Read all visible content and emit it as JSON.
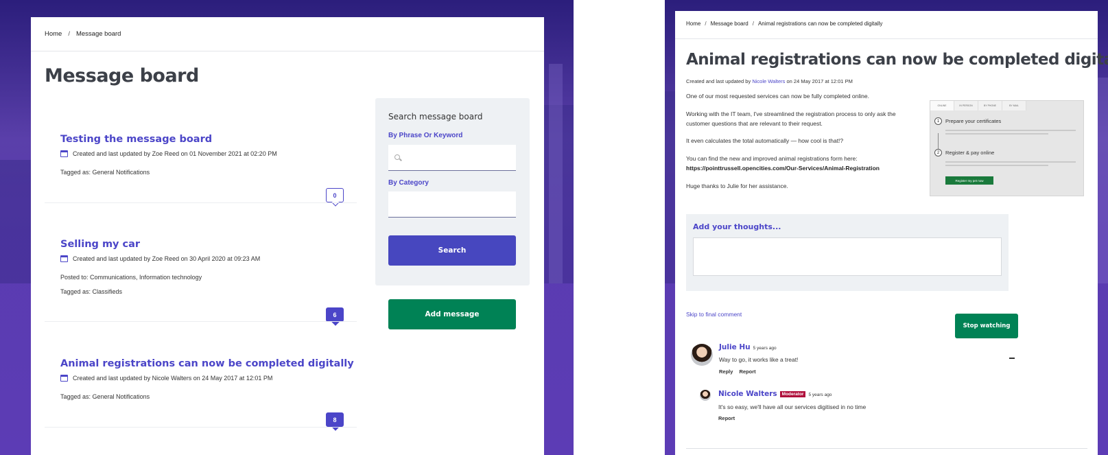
{
  "left": {
    "breadcrumb": [
      "Home",
      "Message board"
    ],
    "page_title": "Message board",
    "messages": [
      {
        "title": "Testing the message board",
        "meta": "Created and last updated by Zoe Reed on 01 November 2021 at 02:20 PM",
        "posted_to": "",
        "tagged": "Tagged as: General Notifications",
        "comment_count": "0"
      },
      {
        "title": "Selling my car",
        "meta": "Created and last updated by Zoe Reed on 30 April 2020 at 09:23 AM",
        "posted_to": "Posted to: Communications, Information technology",
        "tagged": "Tagged as: Classifieds",
        "comment_count": "6"
      },
      {
        "title": "Animal registrations can now be completed digitally",
        "meta": "Created and last updated by Nicole Walters on 24 May 2017 at 12:01 PM",
        "posted_to": "",
        "tagged": "Tagged as: General Notifications",
        "comment_count": "8"
      }
    ],
    "search": {
      "title": "Search message board",
      "keyword_label": "By Phrase Or Keyword",
      "keyword_value": "",
      "category_label": "By Category",
      "category_value": "",
      "button": "Search"
    },
    "add_button": "Add message"
  },
  "right": {
    "breadcrumb": [
      "Home",
      "Message board",
      "Animal registrations can now be completed digitally"
    ],
    "title": "Animal registrations can now be completed digitally",
    "byline_prefix": "Created and last updated by",
    "byline_author": "Nicole Walters",
    "byline_suffix": "on 24 May 2017 at 12:01 PM",
    "paragraphs": [
      "One of our most requested services can now be fully completed online.",
      "Working with the IT team, I've streamlined the registration process to only ask the customer questions that are relevant to their request.",
      "It even calculates the total automatically — how cool is that!?",
      "You can find the new and improved animal registrations form here:",
      "Huge thanks to Julie for her assistance."
    ],
    "link_url": "https://pointtrussell.opencities.com/Our-Services/Animal-Registration",
    "embedded_image": {
      "tabs": [
        "ONLINE",
        "IN PERSON",
        "BY PHONE",
        "BY MAIL"
      ],
      "step1_num": "1",
      "step1": "Prepare your certificates",
      "step2_num": "2",
      "step2": "Register & pay online",
      "button": "Register my pet now"
    },
    "thoughts_title": "Add your thoughts...",
    "thoughts_value": "",
    "skip_link": "Skip to final comment",
    "watch_button": "Stop watching",
    "comments": [
      {
        "name": "Julie Hu",
        "time": "5 years ago",
        "badge": "",
        "text": "Way to go, it works like a treat!",
        "actions": [
          "Reply",
          "Report"
        ]
      },
      {
        "name": "Nicole Walters",
        "time": "5 years ago",
        "badge": "Moderator",
        "text": "It's so easy, we'll have all our services digitised in no time",
        "actions": [
          "Report"
        ]
      }
    ]
  },
  "colors": {
    "accent": "#4b45c8",
    "primary_button": "#4747bf",
    "success_button": "#008255",
    "moderator_badge": "#b0103c",
    "background": "#5a3bb0"
  }
}
